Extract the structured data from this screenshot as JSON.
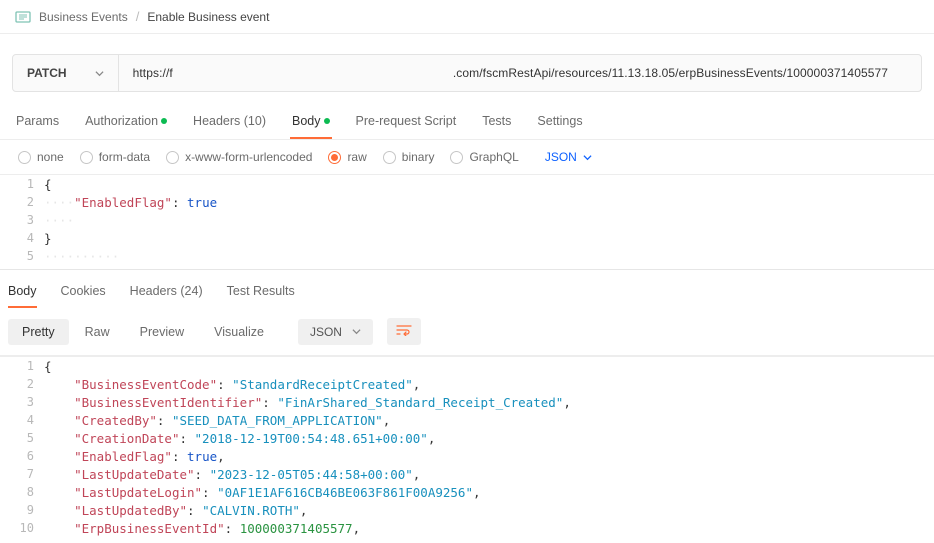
{
  "breadcrumb": {
    "parent": "Business Events",
    "current": "Enable Business event"
  },
  "request": {
    "method": "PATCH",
    "url_pre": "https://f",
    "url_post": ".com/fscmRestApi/resources/11.13.18.05/erpBusinessEvents/100000371405577"
  },
  "tabs": {
    "params": "Params",
    "auth": "Authorization",
    "headers": "Headers (10)",
    "body": "Body",
    "prereq": "Pre-request Script",
    "tests": "Tests",
    "settings": "Settings"
  },
  "bodyOpts": {
    "none": "none",
    "form": "form-data",
    "xwww": "x-www-form-urlencoded",
    "raw": "raw",
    "binary": "binary",
    "graphql": "GraphQL",
    "json": "JSON"
  },
  "reqBody": {
    "l1": "{",
    "l2k": "\"EnabledFlag\"",
    "l2v": "true",
    "l4": "}"
  },
  "respTabs": {
    "body": "Body",
    "cookies": "Cookies",
    "headers": "Headers (24)",
    "tests": "Test Results"
  },
  "view": {
    "pretty": "Pretty",
    "raw": "Raw",
    "preview": "Preview",
    "visualize": "Visualize",
    "fmt": "JSON"
  },
  "resp": {
    "l1": "{",
    "k2": "\"BusinessEventCode\"",
    "v2": "\"StandardReceiptCreated\"",
    "k3": "\"BusinessEventIdentifier\"",
    "v3": "\"FinArShared_Standard_Receipt_Created\"",
    "k4": "\"CreatedBy\"",
    "v4": "\"SEED_DATA_FROM_APPLICATION\"",
    "k5": "\"CreationDate\"",
    "v5": "\"2018-12-19T00:54:48.651+00:00\"",
    "k6": "\"EnabledFlag\"",
    "v6": "true",
    "k7": "\"LastUpdateDate\"",
    "v7": "\"2023-12-05T05:44:58+00:00\"",
    "k8": "\"LastUpdateLogin\"",
    "v8": "\"0AF1E1AF616CB46BE063F861F00A9256\"",
    "k9": "\"LastUpdatedBy\"",
    "v9": "\"CALVIN.ROTH\"",
    "k10": "\"ErpBusinessEventId\"",
    "v10": "100000371405577"
  }
}
